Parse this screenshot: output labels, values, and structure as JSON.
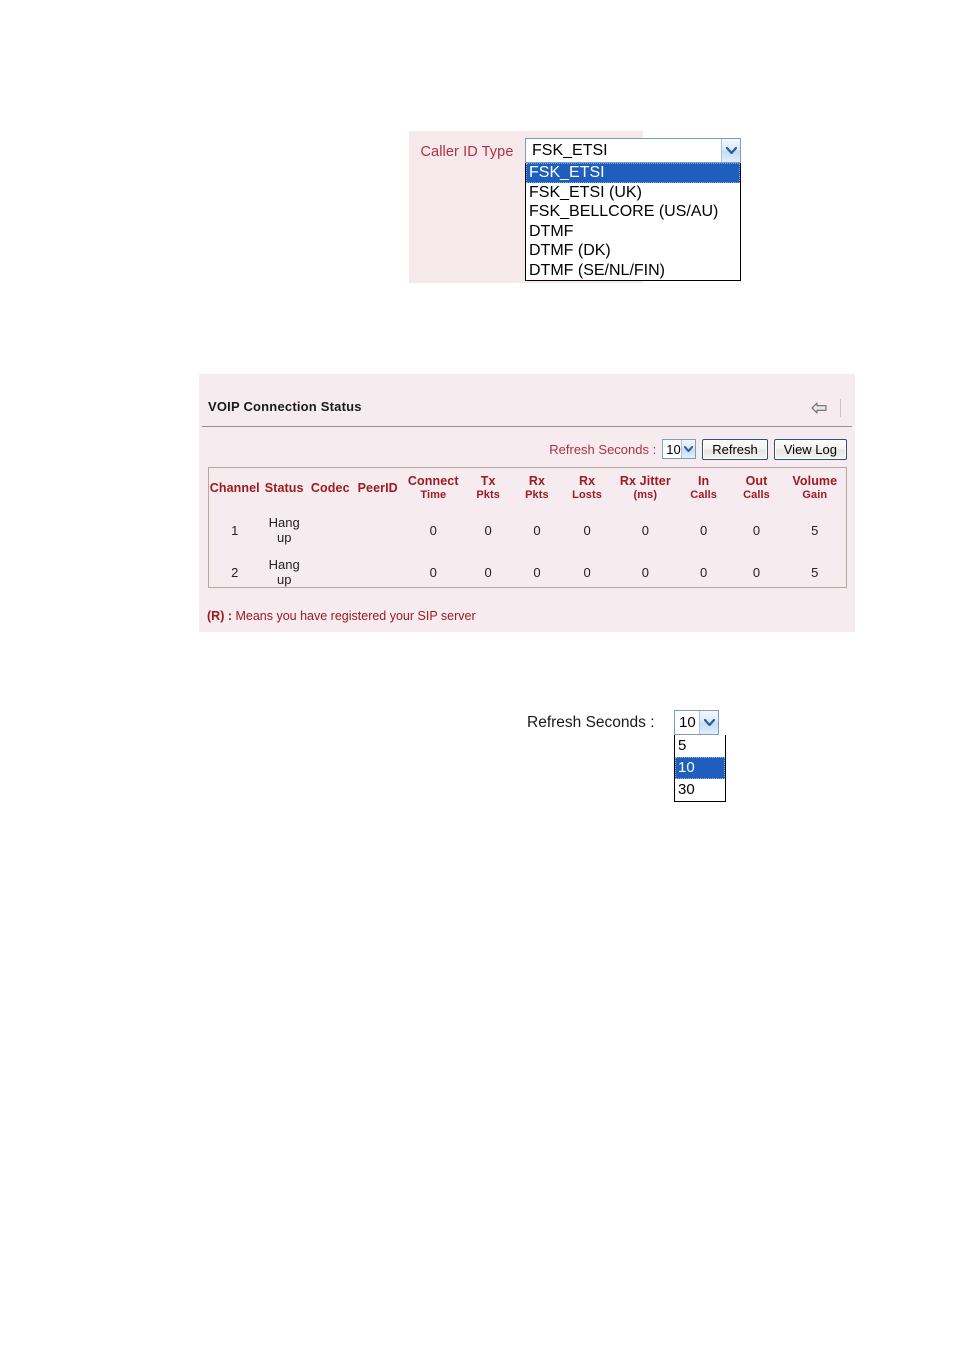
{
  "caller_id": {
    "label": "Caller ID Type",
    "selected": "FSK_ETSI",
    "options": [
      "FSK_ETSI",
      "FSK_ETSI (UK)",
      "FSK_BELLCORE (US/AU)",
      "DTMF",
      "DTMF (DK)",
      "DTMF (SE/NL/FIN)"
    ],
    "dropdown_icon": "chevron-down-icon",
    "panel_bg": "#f6e9ec",
    "label_color": "#b03040",
    "highlight_color": "#1e5fbe"
  },
  "voip_panel": {
    "title": "VOIP Connection Status",
    "back_icon": "arrow-left-icon",
    "panel_bg": "#f6ebee",
    "header_color": "#9e1b20",
    "toolbar": {
      "refresh_seconds_label": "Refresh Seconds :",
      "refresh_seconds_value": "10",
      "refresh_button": "Refresh",
      "view_log_button": "View Log",
      "dropdown_icon": "chevron-down-icon"
    },
    "table": {
      "columns": [
        {
          "line1": "Channel",
          "line2": ""
        },
        {
          "line1": "Status",
          "line2": ""
        },
        {
          "line1": "Codec",
          "line2": ""
        },
        {
          "line1": "PeerID",
          "line2": ""
        },
        {
          "line1": "Connect",
          "line2": "Time"
        },
        {
          "line1": "Tx",
          "line2": "Pkts"
        },
        {
          "line1": "Rx",
          "line2": "Pkts"
        },
        {
          "line1": "Rx",
          "line2": "Losts"
        },
        {
          "line1": "Rx Jitter",
          "line2": "(ms)"
        },
        {
          "line1": "In",
          "line2": "Calls"
        },
        {
          "line1": "Out",
          "line2": "Calls"
        },
        {
          "line1": "Volume",
          "line2": "Gain"
        }
      ],
      "rows": [
        {
          "channel": "1",
          "status_line1": "Hang",
          "status_line2": "up",
          "codec": "",
          "peerid": "",
          "connect_time": "0",
          "tx_pkts": "0",
          "rx_pkts": "0",
          "rx_losts": "0",
          "rx_jitter": "0",
          "in_calls": "0",
          "out_calls": "0",
          "volume_gain": "5"
        },
        {
          "channel": "2",
          "status_line1": "Hang",
          "status_line2": "up",
          "codec": "",
          "peerid": "",
          "connect_time": "0",
          "tx_pkts": "0",
          "rx_pkts": "0",
          "rx_losts": "0",
          "rx_jitter": "0",
          "in_calls": "0",
          "out_calls": "0",
          "volume_gain": "5"
        }
      ]
    },
    "footnote_key": "(R) :",
    "footnote_text": " Means you have registered your SIP server"
  },
  "refresh_standalone": {
    "label": "Refresh Seconds :",
    "selected": "10",
    "options": [
      "5",
      "10",
      "30"
    ],
    "dropdown_icon": "chevron-down-icon",
    "highlight_color": "#1e5fbe"
  }
}
